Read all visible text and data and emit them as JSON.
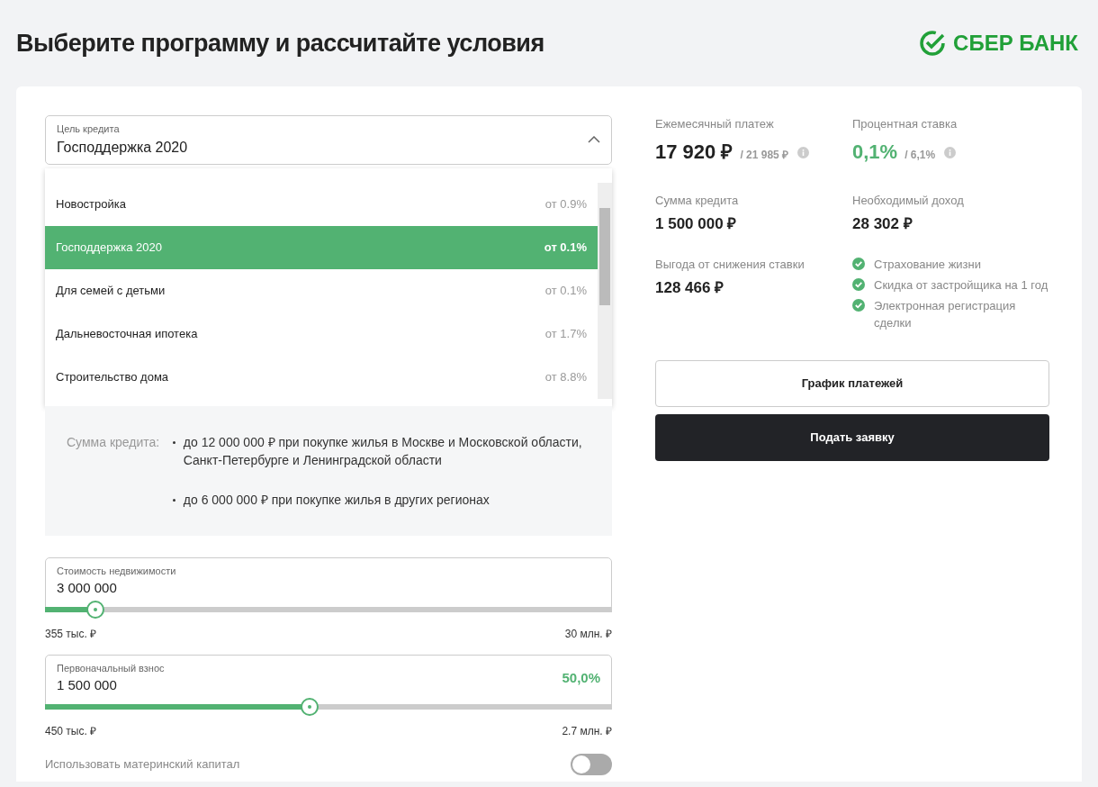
{
  "header": {
    "title": "Выберите программу и рассчитайте условия",
    "logo_text": "СБЕР БАНК"
  },
  "purpose_select": {
    "label": "Цель кредита",
    "value": "Господдержка 2020",
    "expanded": true
  },
  "purpose_options": [
    {
      "name": "Новостройка",
      "rate": "от 0.9%",
      "selected": false
    },
    {
      "name": "Господдержка 2020",
      "rate": "от 0.1%",
      "selected": true
    },
    {
      "name": "Для семей с детьми",
      "rate": "от 0.1%",
      "selected": false
    },
    {
      "name": "Дальневосточная ипотека",
      "rate": "от 1.7%",
      "selected": false
    },
    {
      "name": "Строительство дома",
      "rate": "от 8.8%",
      "selected": false
    }
  ],
  "info_panel": {
    "label": "Сумма кредита:",
    "bullets": [
      "до 12 000 000 ₽ при покупке жилья в Москве и Московской области, Санкт-Петербурге и Ленинградской области",
      "до 6 000 000 ₽ при покупке жилья в других регионах"
    ]
  },
  "sliders": [
    {
      "label": "Стоимость недвижимости",
      "value": "3 000 000",
      "level": 0.089,
      "min": "355 тыс. ₽",
      "max": "30 млн. ₽"
    },
    {
      "label": "Первоначальный взнос",
      "value": "1 500 000",
      "percent": "50,0%",
      "level": 0.467,
      "min": "450 тыс. ₽",
      "max": "2.7 млн. ₽"
    }
  ],
  "maternity_capital": {
    "label": "Использовать материнский капитал",
    "on": false
  },
  "summary": [
    {
      "label": "Ежемесячный платеж",
      "value": "17 920 ₽",
      "old_value": "/ 21 985 ₽",
      "info": true,
      "accent": false
    },
    {
      "label": "Процентная ставка",
      "value": "0,1%",
      "old_value": "/ 6,1%",
      "info": true,
      "accent": true
    },
    {
      "label": "Сумма кредита",
      "value": "1 500 000 ₽",
      "info": false,
      "accent": false
    },
    {
      "label": "Необходимый доход",
      "value": "28 302 ₽",
      "info": false,
      "accent": false
    },
    {
      "label": "Выгода от снижения ставки",
      "value": "128 466 ₽",
      "info": false,
      "accent": false
    }
  ],
  "features": [
    "Страхование жизни",
    "Скидка от застройщика на 1 год",
    "Электронная регистрация сделки"
  ],
  "buttons": [
    {
      "label": "График платежей",
      "kind": "outline"
    },
    {
      "label": "Подать заявку",
      "kind": "dark"
    }
  ]
}
